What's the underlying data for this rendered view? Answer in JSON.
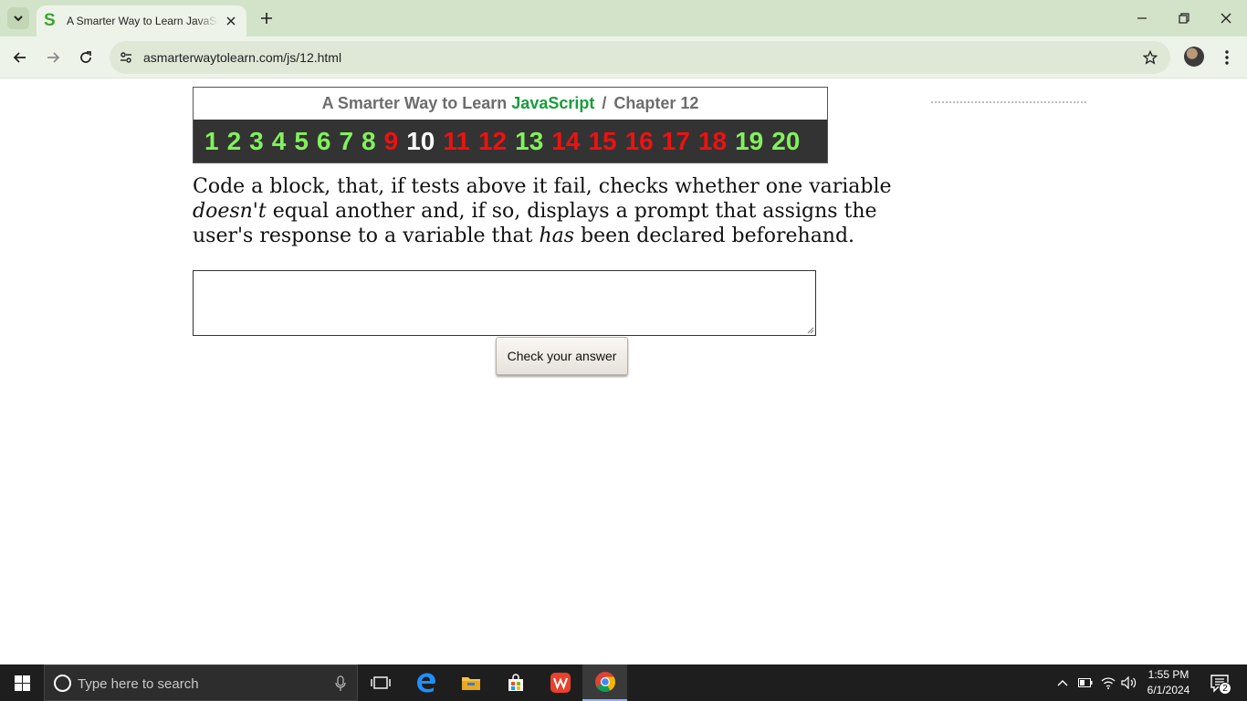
{
  "browser": {
    "tab_title": "A Smarter Way to Learn JavaScript",
    "tab_favicon_letter": "S",
    "url": "asmarterwaytolearn.com/js/12.html"
  },
  "page": {
    "title_prefix": "A Smarter Way to Learn",
    "title_highlight": "JavaScript",
    "title_separator": "/",
    "chapter_label": "Chapter 12",
    "chapters": [
      {
        "label": "1",
        "status": "green"
      },
      {
        "label": "2",
        "status": "green"
      },
      {
        "label": "3",
        "status": "green"
      },
      {
        "label": "4",
        "status": "green"
      },
      {
        "label": "5",
        "status": "green"
      },
      {
        "label": "6",
        "status": "green"
      },
      {
        "label": "7",
        "status": "green"
      },
      {
        "label": "8",
        "status": "green"
      },
      {
        "label": "9",
        "status": "red"
      },
      {
        "label": "10",
        "status": "current"
      },
      {
        "label": "11",
        "status": "red"
      },
      {
        "label": "12",
        "status": "red"
      },
      {
        "label": "13",
        "status": "green"
      },
      {
        "label": "14",
        "status": "red"
      },
      {
        "label": "15",
        "status": "red"
      },
      {
        "label": "16",
        "status": "red"
      },
      {
        "label": "17",
        "status": "red"
      },
      {
        "label": "18",
        "status": "red"
      },
      {
        "label": "19",
        "status": "green"
      },
      {
        "label": "20",
        "status": "green"
      }
    ],
    "instruction_part1": "Code a block, that, if tests above it fail, checks whether one variable ",
    "instruction_em1": "doesn't",
    "instruction_part2": " equal another and, if so, displays a prompt that assigns the user's response to a variable that ",
    "instruction_em2": "has",
    "instruction_part3": " been declared beforehand.",
    "answer_value": "",
    "check_button_label": "Check your answer"
  },
  "taskbar": {
    "search_placeholder": "Type here to search",
    "time": "1:55 PM",
    "date": "6/1/2024",
    "notification_count": "2"
  },
  "colors": {
    "chapter_green": "#82f25b",
    "chapter_red": "#ee1111",
    "chapter_current": "#ffffff",
    "title_highlight": "#189d3a"
  }
}
